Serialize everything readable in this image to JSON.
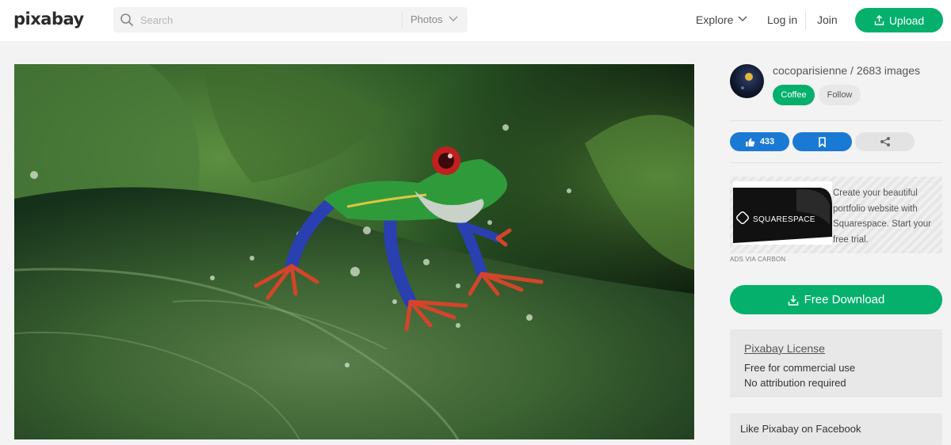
{
  "header": {
    "logo": "pixabay",
    "search_placeholder": "Search",
    "search_type": "Photos",
    "nav_explore": "Explore",
    "nav_login": "Log in",
    "nav_join": "Join",
    "upload_label": "Upload"
  },
  "photo": {
    "icon": "photo-frog-on-leaf"
  },
  "sidebar": {
    "author_line": "cocoparisienne / 2683 images",
    "coffee_label": "Coffee",
    "follow_label": "Follow",
    "like_count": "433",
    "ad": {
      "brand": "SQUARESPACE",
      "text": "Create your beautiful portfolio website with Squarespace. Start your free trial.",
      "label": "ADS VIA CARBON"
    },
    "download_label": "Free Download",
    "license": {
      "title": "Pixabay License",
      "line1": "Free for commercial use",
      "line2": "No attribution required"
    },
    "facebook_text": "Like Pixabay on Facebook"
  },
  "colors": {
    "brand_green": "#05b06d",
    "action_blue": "#1a7ad3"
  }
}
